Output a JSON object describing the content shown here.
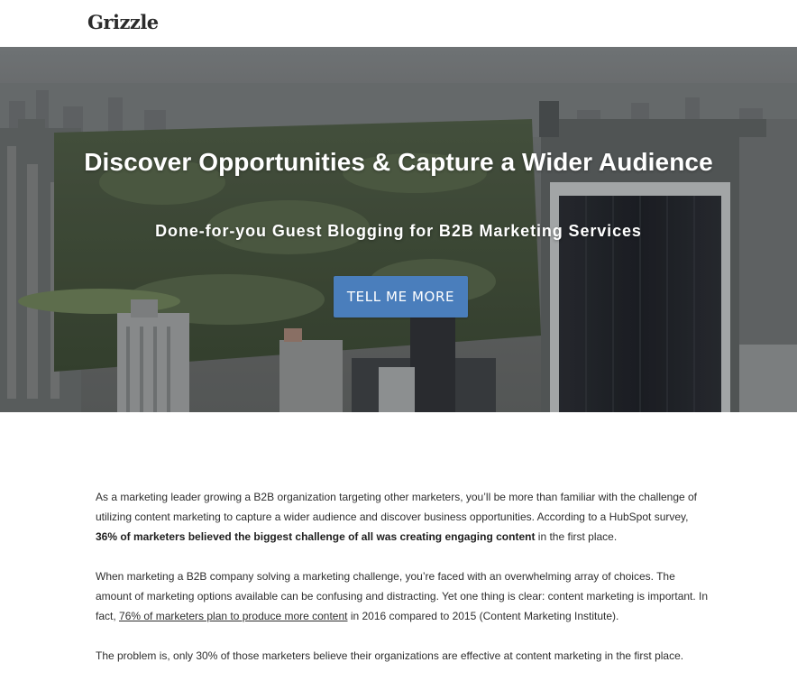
{
  "header": {
    "logo": "Grizzle"
  },
  "hero": {
    "title": "Discover Opportunities & Capture a Wider Audience",
    "subtitle": "Done-for-you Guest Blogging for B2B Marketing Services",
    "cta_label": "TELL ME MORE"
  },
  "content": {
    "p1": {
      "text_a": "As a marketing leader growing a B2B organization targeting other marketers, you’ll be more than familiar with the challenge of utilizing content marketing to capture a wider audience and discover business opportunities. According to a HubSpot survey, ",
      "bold": "36% of marketers believed the biggest challenge of all was creating engaging content",
      "text_b": " in the first place."
    },
    "p2": {
      "text_a": "When marketing a B2B company solving a marketing challenge, you’re faced with an overwhelming array of choices. The amount of marketing options available can be confusing and distracting. Yet one thing is clear: content marketing is important. In fact, ",
      "link": "76% of marketers plan to produce more content",
      "text_b": " in 2016 compared to 2015 (Content Marketing Institute)."
    },
    "p3": {
      "text": "The problem is, only 30% of those marketers believe their organizations are effective at content marketing in the first place."
    }
  },
  "colors": {
    "cta": "#4a7ebc",
    "text": "#2e2e2e",
    "logo": "#2b2b2b"
  }
}
